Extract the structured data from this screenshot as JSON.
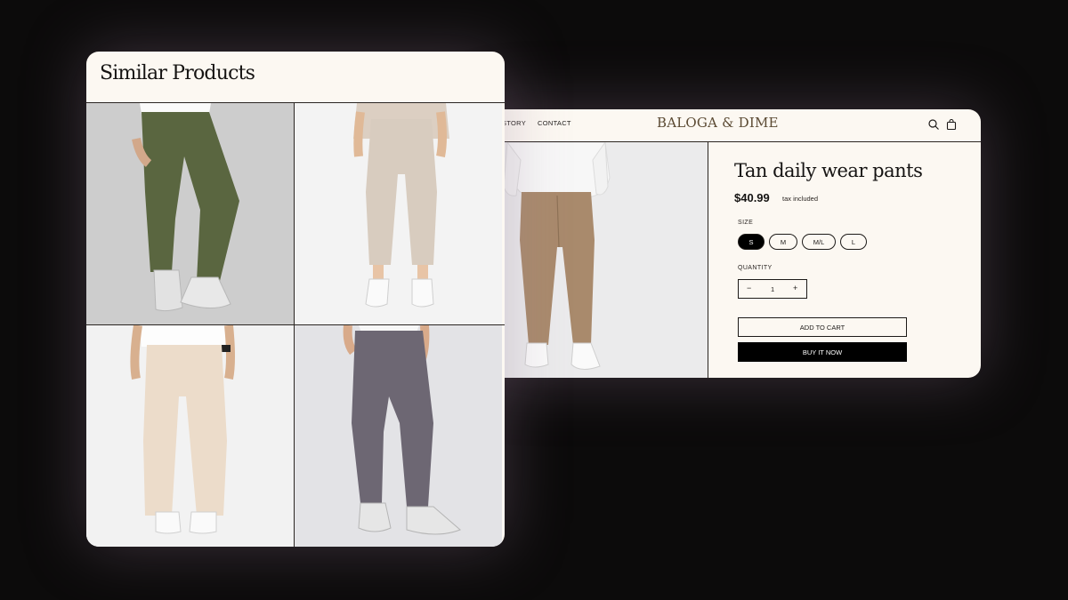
{
  "similar": {
    "title": "Similar Products",
    "products": [
      {
        "color_name": "olive",
        "pants_color": "#5a6640"
      },
      {
        "color_name": "beige",
        "pants_color": "#d8ccbf"
      },
      {
        "color_name": "cream",
        "pants_color": "#ecdcca"
      },
      {
        "color_name": "grey",
        "pants_color": "#6d6773"
      }
    ]
  },
  "product_page": {
    "nav": {
      "story": "STORY",
      "contact": "CONTACT",
      "logo": "BALOGA & DIME"
    },
    "icons": [
      "search-icon",
      "bag-icon"
    ],
    "title": "Tan daily wear pants",
    "price": "$40.99",
    "tax_note": "tax included",
    "size_label": "SIZE",
    "sizes": [
      "S",
      "M",
      "M/L",
      "L"
    ],
    "selected_size": "S",
    "quantity_label": "QUANTITY",
    "quantity": "1",
    "stepper_minus": "−",
    "stepper_plus": "+",
    "add_to_cart": "ADD TO CART",
    "buy_now": "BUY IT NOW",
    "main_pants_color": "#a98a6c"
  }
}
